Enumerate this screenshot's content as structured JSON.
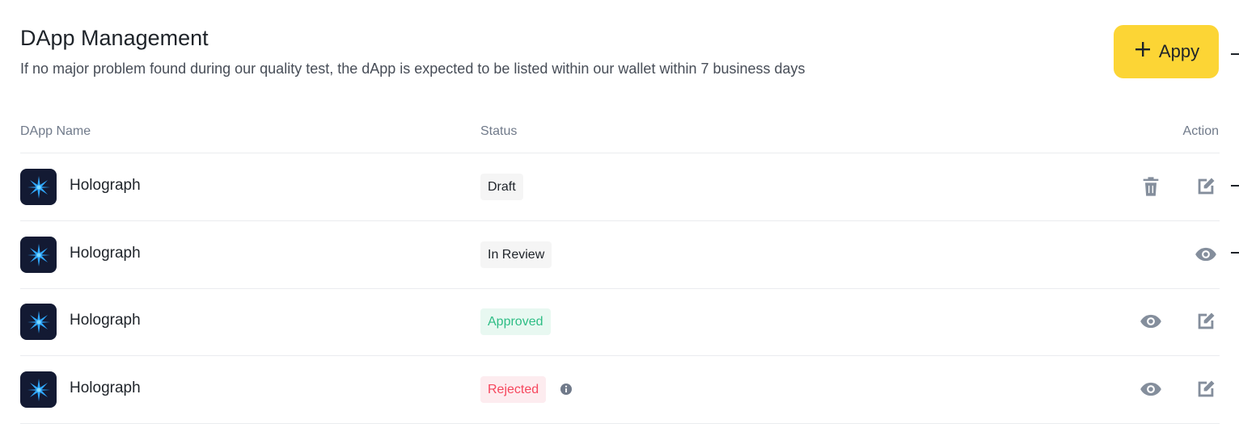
{
  "header": {
    "title": "DApp Management",
    "subtitle": "If no major problem found during our quality test, the dApp is expected to be listed within our wallet within 7 business days",
    "apply_label": "Appy"
  },
  "table": {
    "columns": {
      "name": "DApp Name",
      "status": "Status",
      "action": "Action"
    },
    "rows": [
      {
        "name": "Holograph",
        "status": "Draft",
        "status_kind": "draft",
        "actions": [
          "delete",
          "edit"
        ]
      },
      {
        "name": "Holograph",
        "status": "In Review",
        "status_kind": "review",
        "actions": [
          "view"
        ]
      },
      {
        "name": "Holograph",
        "status": "Approved",
        "status_kind": "approved",
        "actions": [
          "view",
          "edit"
        ]
      },
      {
        "name": "Holograph",
        "status": "Rejected",
        "status_kind": "rejected",
        "actions": [
          "view",
          "edit"
        ],
        "has_info": true
      }
    ]
  },
  "colors": {
    "accent": "#fcd535",
    "approved": "#2ebd85",
    "rejected": "#f6465d",
    "icon_gray": "#848e9c"
  },
  "icons": [
    "plus-icon",
    "app-logo-icon",
    "trash-icon",
    "edit-icon",
    "eye-icon",
    "info-icon"
  ]
}
